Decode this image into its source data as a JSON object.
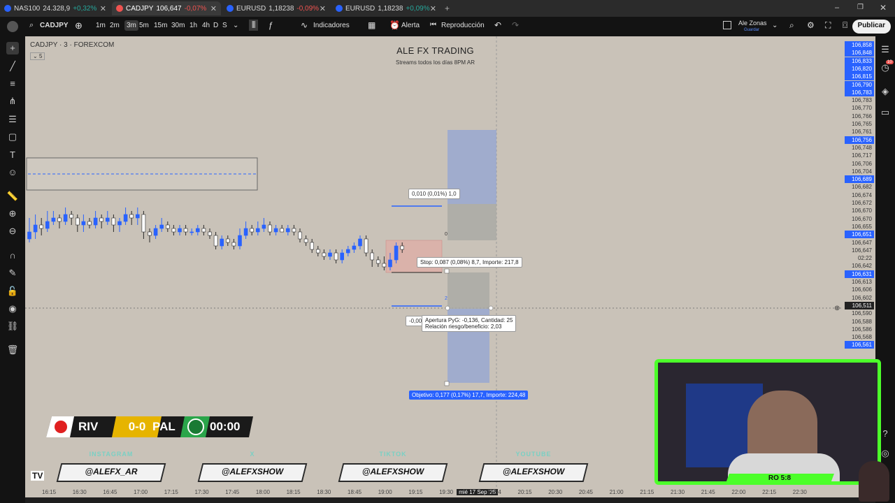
{
  "tabs": [
    {
      "symbol": "NAS100",
      "price": "24.328,9",
      "change": "+0,32%",
      "dir": "up",
      "icon_color": "#2962ff"
    },
    {
      "symbol": "CADJPY",
      "price": "106,647",
      "change": "-0,07%",
      "dir": "down",
      "icon_color": "#ef5350"
    },
    {
      "symbol": "EURUSD",
      "price": "1,18238",
      "change": "-0,09%",
      "dir": "down",
      "icon_color": "#2962ff"
    },
    {
      "symbol": "EURUSD",
      "price": "1,18238",
      "change": "+0,09%",
      "dir": "up",
      "icon_color": "#2962ff"
    }
  ],
  "toolbar": {
    "symbol": "CADJPY",
    "intervals": [
      "1m",
      "2m",
      "3m",
      "5m",
      "15m",
      "30m",
      "1h",
      "4h",
      "D",
      "S"
    ],
    "selected_interval": "3m",
    "indicators": "Indicadores",
    "alert": "Alerta",
    "replay": "Reproducción",
    "user": "Ale Zonas",
    "user_sub": "Guardar",
    "publish": "Publicar"
  },
  "chart": {
    "title": "CADJPY · 3 · FOREXCOM",
    "legend_toggle": "5",
    "brand": "ALE FX TRADING",
    "brand_sub": "Streams todos los días 8PM AR",
    "labels": {
      "top_box": "0,010 (0,01%) 1,0",
      "stop": "Stop: 0,087 (0,08%) 8,7, Importe: 217,8",
      "open_pnl": "Apertura PyG: -0,136, Cantidad: 25",
      "risk_reward": "Relación riesgo/beneficio: 2,03",
      "target": "Objetivo: 0,177 (0,17%) 17,7, Importe: 224,48",
      "left_partial": "-0,00",
      "marker_zero": "0",
      "marker_two": "2"
    }
  },
  "price_axis": [
    {
      "v": "106,858",
      "s": "blue"
    },
    {
      "v": "106,848",
      "s": "blue"
    },
    {
      "v": "106,833",
      "s": "blue"
    },
    {
      "v": "106,820",
      "s": "blue"
    },
    {
      "v": "106,815",
      "s": "blue"
    },
    {
      "v": "106,790",
      "s": "blue"
    },
    {
      "v": "106,783",
      "s": "blue"
    },
    {
      "v": "106,783",
      "s": ""
    },
    {
      "v": "106,770",
      "s": ""
    },
    {
      "v": "106,766",
      "s": ""
    },
    {
      "v": "106,765",
      "s": ""
    },
    {
      "v": "106,761",
      "s": ""
    },
    {
      "v": "106,756",
      "s": "blue"
    },
    {
      "v": "106,748",
      "s": ""
    },
    {
      "v": "106,717",
      "s": ""
    },
    {
      "v": "106,706",
      "s": ""
    },
    {
      "v": "106,704",
      "s": ""
    },
    {
      "v": "106,689",
      "s": "blue"
    },
    {
      "v": "106,682",
      "s": ""
    },
    {
      "v": "106,674",
      "s": ""
    },
    {
      "v": "106,672",
      "s": ""
    },
    {
      "v": "106,670",
      "s": ""
    },
    {
      "v": "106,670",
      "s": ""
    },
    {
      "v": "106,655",
      "s": ""
    },
    {
      "v": "106,651",
      "s": "blue"
    },
    {
      "v": "106,647",
      "s": ""
    },
    {
      "v": "106,647",
      "s": ""
    },
    {
      "v": "02:22",
      "s": ""
    },
    {
      "v": "106,642",
      "s": ""
    },
    {
      "v": "106,631",
      "s": "blue"
    },
    {
      "v": "106,613",
      "s": ""
    },
    {
      "v": "106,606",
      "s": ""
    },
    {
      "v": "106,602",
      "s": ""
    },
    {
      "v": "106,511",
      "s": "dark"
    },
    {
      "v": "106,590",
      "s": ""
    },
    {
      "v": "106,588",
      "s": ""
    },
    {
      "v": "106,586",
      "s": ""
    },
    {
      "v": "106,568",
      "s": ""
    },
    {
      "v": "106,561",
      "s": "blue"
    }
  ],
  "time_axis": [
    "16:15",
    "16:30",
    "16:45",
    "17:00",
    "17:15",
    "17:30",
    "17:45",
    "18:00",
    "18:15",
    "18:30",
    "18:45",
    "19:00",
    "19:15",
    "19:30",
    "mié 17 Sep '25",
    "19:54",
    "20:15",
    "20:30",
    "20:45",
    "21:00",
    "21:15",
    "21:30",
    "21:45",
    "22:00",
    "22:15",
    "22:30"
  ],
  "scoreboard": {
    "home": "RIV",
    "score": "0-0",
    "away": "PAL",
    "clock": "00:00"
  },
  "socials": [
    {
      "network": "INSTAGRAM",
      "handle": "@ALEFX_AR"
    },
    {
      "network": "X",
      "handle": "@ALEFXSHOW"
    },
    {
      "network": "TIKTOK",
      "handle": "@ALEFXSHOW"
    },
    {
      "network": "YOUTUBE",
      "handle": "@ALEFXSHOW"
    }
  ],
  "webcam": {
    "tag": "RO 5:8"
  },
  "notifications": {
    "count": "10"
  },
  "colors": {
    "accent": "#2962ff",
    "up": "#26a69a",
    "down": "#ef5350",
    "cam_border": "#4cff2a",
    "chart_bg": "#c9c2b8"
  },
  "candles": [
    [
      106.6,
      106.62,
      106.66,
      106.59
    ],
    [
      106.62,
      106.64,
      106.67,
      106.6
    ],
    [
      106.64,
      106.63,
      106.66,
      106.61
    ],
    [
      106.63,
      106.65,
      106.68,
      106.62
    ],
    [
      106.65,
      106.66,
      106.68,
      106.64
    ],
    [
      106.66,
      106.65,
      106.67,
      106.63
    ],
    [
      106.65,
      106.67,
      106.69,
      106.64
    ],
    [
      106.67,
      106.66,
      106.68,
      106.64
    ],
    [
      106.66,
      106.64,
      106.67,
      106.62
    ],
    [
      106.64,
      106.65,
      106.67,
      106.62
    ],
    [
      106.65,
      106.64,
      106.66,
      106.63
    ],
    [
      106.64,
      106.66,
      106.68,
      106.63
    ],
    [
      106.66,
      106.65,
      106.67,
      106.63
    ],
    [
      106.65,
      106.66,
      106.68,
      106.64
    ],
    [
      106.66,
      106.64,
      106.67,
      106.62
    ],
    [
      106.64,
      106.65,
      106.66,
      106.62
    ],
    [
      106.65,
      106.67,
      106.69,
      106.64
    ],
    [
      106.67,
      106.66,
      106.68,
      106.64
    ],
    [
      106.66,
      106.67,
      106.69,
      106.64
    ],
    [
      106.67,
      106.62,
      106.68,
      106.6
    ],
    [
      106.62,
      106.61,
      106.63,
      106.59
    ],
    [
      106.61,
      106.63,
      106.64,
      106.6
    ],
    [
      106.63,
      106.64,
      106.66,
      106.62
    ],
    [
      106.64,
      106.63,
      106.65,
      106.62
    ],
    [
      106.63,
      106.62,
      106.64,
      106.61
    ],
    [
      106.62,
      106.63,
      106.64,
      106.61
    ],
    [
      106.63,
      106.62,
      106.64,
      106.61
    ],
    [
      106.62,
      106.62,
      106.63,
      106.61
    ],
    [
      106.62,
      106.63,
      106.64,
      106.61
    ],
    [
      106.63,
      106.62,
      106.64,
      106.61
    ],
    [
      106.62,
      106.61,
      106.63,
      106.6
    ],
    [
      106.61,
      106.58,
      106.62,
      106.57
    ],
    [
      106.58,
      106.6,
      106.61,
      106.57
    ],
    [
      106.6,
      106.59,
      106.61,
      106.58
    ],
    [
      106.59,
      106.58,
      106.6,
      106.57
    ],
    [
      106.58,
      106.61,
      106.63,
      106.57
    ],
    [
      106.61,
      106.63,
      106.65,
      106.6
    ],
    [
      106.63,
      106.62,
      106.64,
      106.61
    ],
    [
      106.62,
      106.63,
      106.65,
      106.61
    ],
    [
      106.63,
      106.64,
      106.66,
      106.62
    ],
    [
      106.64,
      106.62,
      106.65,
      106.61
    ],
    [
      106.62,
      106.63,
      106.64,
      106.61
    ],
    [
      106.63,
      106.62,
      106.64,
      106.62
    ],
    [
      106.62,
      106.63,
      106.64,
      106.61
    ],
    [
      106.63,
      106.62,
      106.64,
      106.61
    ],
    [
      106.62,
      106.6,
      106.63,
      106.59
    ],
    [
      106.6,
      106.59,
      106.61,
      106.58
    ],
    [
      106.59,
      106.57,
      106.6,
      106.56
    ],
    [
      106.57,
      106.56,
      106.58,
      106.55
    ],
    [
      106.56,
      106.55,
      106.57,
      106.54
    ],
    [
      106.55,
      106.56,
      106.57,
      106.54
    ],
    [
      106.56,
      106.54,
      106.57,
      106.53
    ],
    [
      106.54,
      106.56,
      106.57,
      106.53
    ],
    [
      106.56,
      106.57,
      106.58,
      106.55
    ],
    [
      106.57,
      106.58,
      106.59,
      106.56
    ],
    [
      106.58,
      106.6,
      106.61,
      106.57
    ],
    [
      106.6,
      106.56,
      106.61,
      106.55
    ],
    [
      106.56,
      106.54,
      106.57,
      106.52
    ],
    [
      106.54,
      106.53,
      106.55,
      106.52
    ],
    [
      106.53,
      106.52,
      106.55,
      106.51
    ],
    [
      106.52,
      106.54,
      106.56,
      106.51
    ],
    [
      106.54,
      106.58,
      106.59,
      106.53
    ],
    [
      106.58,
      106.57,
      106.59,
      106.56
    ]
  ]
}
